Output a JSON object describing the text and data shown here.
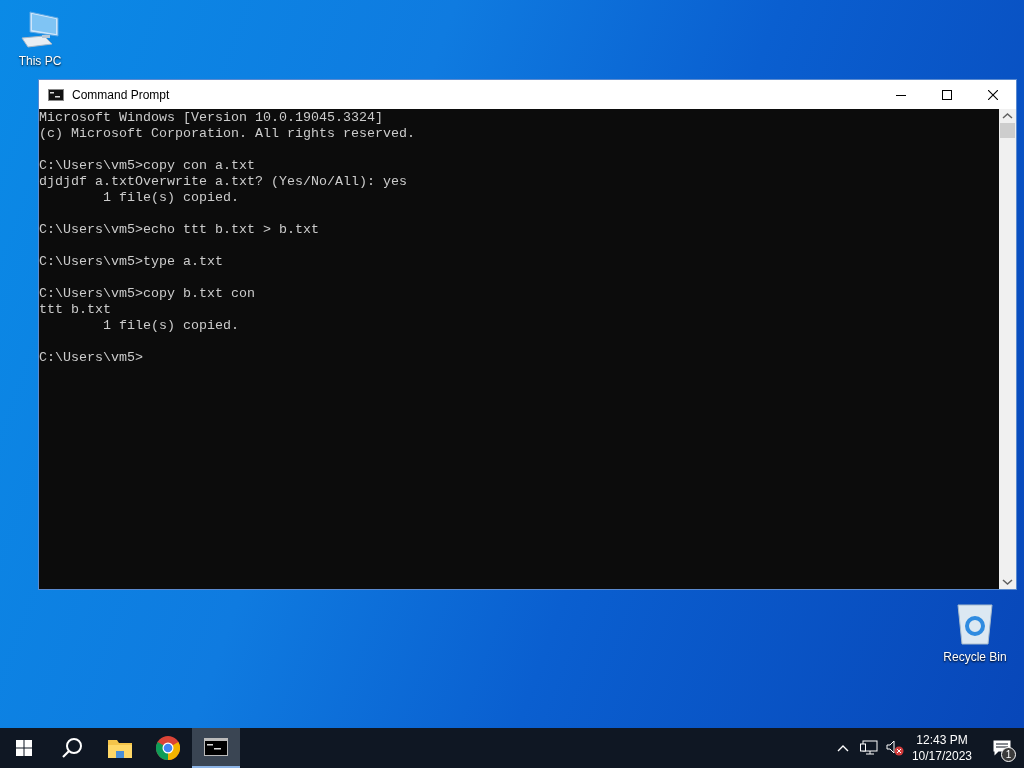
{
  "desktop_icons": [
    {
      "kind": "computer",
      "label": "This PC"
    },
    {
      "kind": "recycle",
      "label": "Recycle Bin"
    }
  ],
  "window": {
    "title": "Command Prompt",
    "console_blocks": [
      [
        "Microsoft Windows [Version 10.0.19045.3324]",
        "(c) Microsoft Corporation. All rights reserved."
      ],
      [
        "C:\\Users\\vm5>copy con a.txt",
        "djdjdf a.txtOverwrite a.txt? (Yes/No/All): yes",
        "        1 file(s) copied."
      ],
      [
        "C:\\Users\\vm5>echo ttt b.txt > b.txt"
      ],
      [
        "C:\\Users\\vm5>type a.txt"
      ],
      [
        "C:\\Users\\vm5>copy b.txt con",
        "ttt b.txt",
        "        1 file(s) copied."
      ],
      [
        "C:\\Users\\vm5>"
      ]
    ]
  },
  "taskbar": {
    "items": [
      {
        "kind": "start",
        "selected": false
      },
      {
        "kind": "search",
        "selected": false
      },
      {
        "kind": "folder",
        "selected": false
      },
      {
        "kind": "browser",
        "selected": false
      },
      {
        "kind": "console",
        "selected": true
      }
    ],
    "clock": {
      "time": "12:43 PM",
      "date": "10/17/2023"
    },
    "notification_count": "1"
  }
}
